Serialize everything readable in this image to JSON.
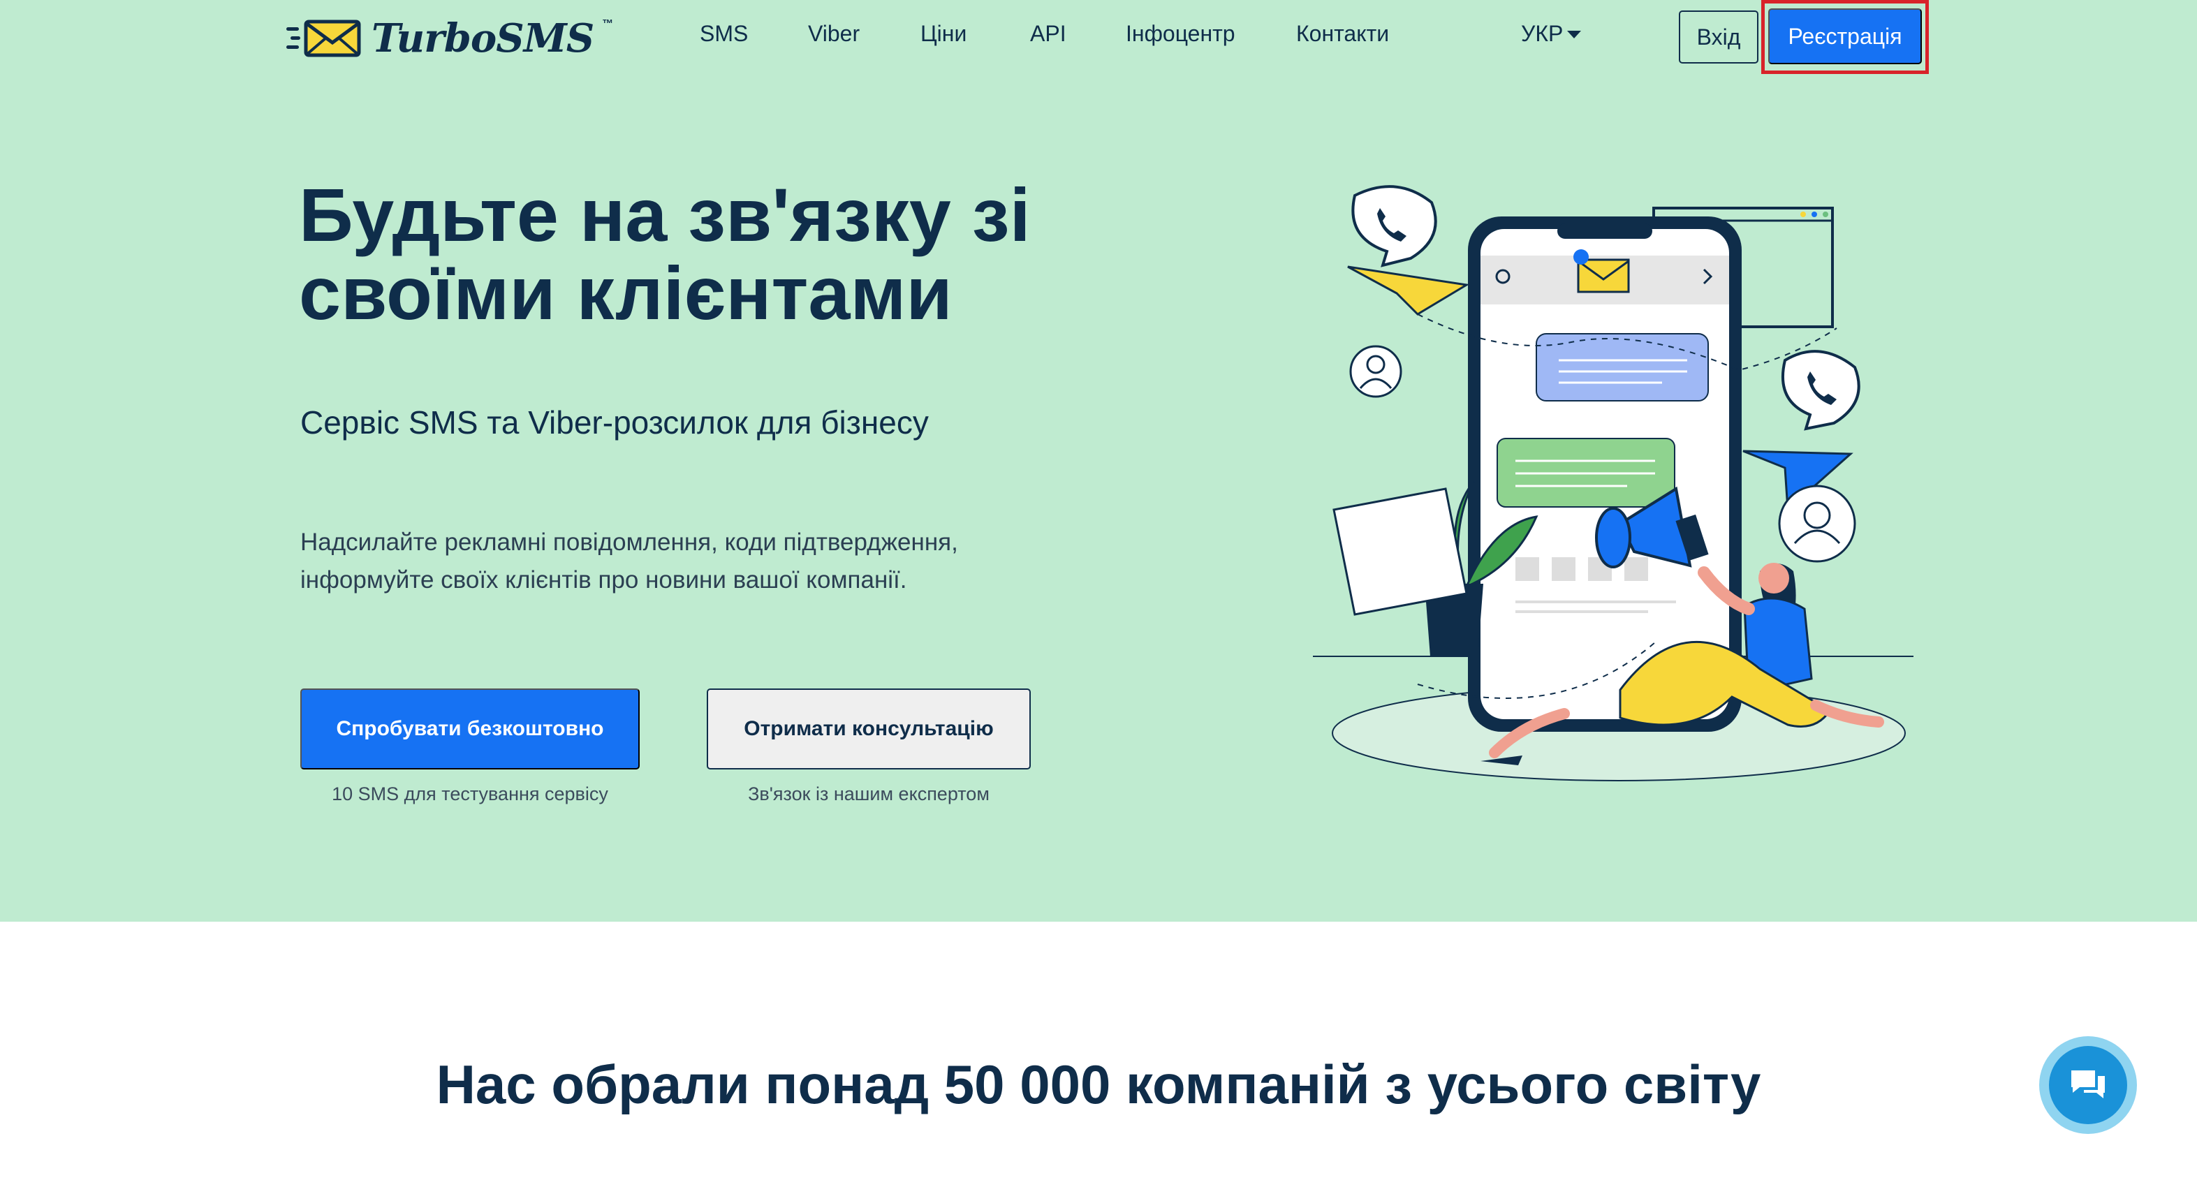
{
  "header": {
    "logo_text": "TurboSMS",
    "logo_tm": "™",
    "nav": [
      "SMS",
      "Viber",
      "Ціни",
      "API",
      "Інфоцентр",
      "Контакти"
    ],
    "language": "УКР",
    "login_label": "Вхід",
    "register_label": "Реєстрація"
  },
  "hero": {
    "title_line1": "Будьте на зв'язку зі",
    "title_line2": "своїми клієнтами",
    "subtitle": "Сервіс SMS та Viber-розсилок для бізнесу",
    "description_line1": "Надсилайте рекламні повідомлення, коди підтвердження,",
    "description_line2": "інформуйте своїх клієнтів про новини вашої компанії.",
    "try_button": "Спробувати безкоштовно",
    "try_caption": "10 SMS для тестування сервісу",
    "consult_button": "Отримати консультацію",
    "consult_caption": "Зв'язок із нашим експертом"
  },
  "companies_heading": "Нас обрали понад 50 000 компаній з усього світу",
  "colors": {
    "hero_bg": "#bfebd0",
    "primary": "#1672f3",
    "text_dark": "#0f2d4a",
    "highlight": "#d8232a"
  }
}
